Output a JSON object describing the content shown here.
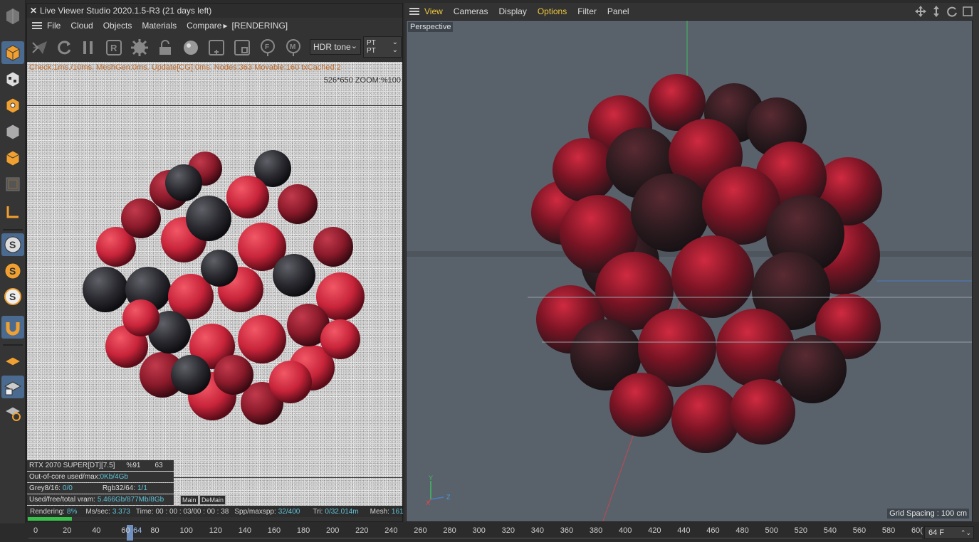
{
  "live_viewer": {
    "title": "Live Viewer Studio 2020.1.5-R3 (21 days left)",
    "menu": [
      "File",
      "Cloud",
      "Objects",
      "Materials",
      "Compare",
      "[RENDERING]"
    ],
    "hdr_tone": "HDR tone",
    "pt1": "PT",
    "pt2": "PT",
    "stats_line": "Check:1ms./10ms. MeshGen:0ms. Update[CG]:0ms. Nodes:363 Movable:160 txCached:2",
    "zoom_line": "526*650 ZOOM:%100",
    "gpu": {
      "name": "RTX 2070 SUPER[DT][7.5]",
      "pct": "%91",
      "temp": "63"
    },
    "out_of_core": {
      "label": "Out-of-core used/max:",
      "value": "0Kb/4Gb"
    },
    "grey": {
      "label": "Grey8/16:",
      "value": "0/0"
    },
    "rgb": {
      "label": "Rgb32/64:",
      "value": "1/1"
    },
    "vram": {
      "label": "Used/free/total vram:",
      "value": "5.466Gb/877Mb/8Gb"
    },
    "tags": [
      "Main",
      "DeMain"
    ],
    "status": {
      "rendering_label": "Rendering:",
      "rendering_value": "8%",
      "ms_label": "Ms/sec:",
      "ms_value": "3.373",
      "time_label": "Time:",
      "time_value": "00 : 00 : 03/00 : 00 : 38",
      "spp_label": "Spp/maxspp:",
      "spp_value": "32/400",
      "tri_label": "Tri:",
      "tri_value": "0/32.014m",
      "mesh_label": "Mesh:",
      "mesh_value": "161"
    },
    "progress_fraction": 0.08
  },
  "viewport": {
    "menu": [
      "View",
      "Cameras",
      "Display",
      "Options",
      "Filter",
      "Panel"
    ],
    "highlighted": [
      "View",
      "Options"
    ],
    "camera_label": "Perspective",
    "grid_spacing": "Grid Spacing : 100 cm",
    "axis_labels": {
      "y": "Y",
      "z": "Z",
      "x": "X"
    }
  },
  "timeline": {
    "ticks": [
      "0",
      "20",
      "40",
      "60",
      "80",
      "100",
      "120",
      "140",
      "160",
      "180",
      "200",
      "220",
      "240",
      "260",
      "280",
      "300",
      "320",
      "340",
      "360",
      "380",
      "400",
      "420",
      "440",
      "460",
      "480",
      "500",
      "520",
      "540",
      "560",
      "580",
      "60("
    ],
    "current_frame_label": "64",
    "frame_field": "64 F"
  },
  "colors": {
    "accent_yellow": "#f0c83c",
    "stat_orange": "#c06a28",
    "value_cyan": "#5fc2d8",
    "progress_green": "#36c24a",
    "viewport_bg": "#59616b"
  }
}
